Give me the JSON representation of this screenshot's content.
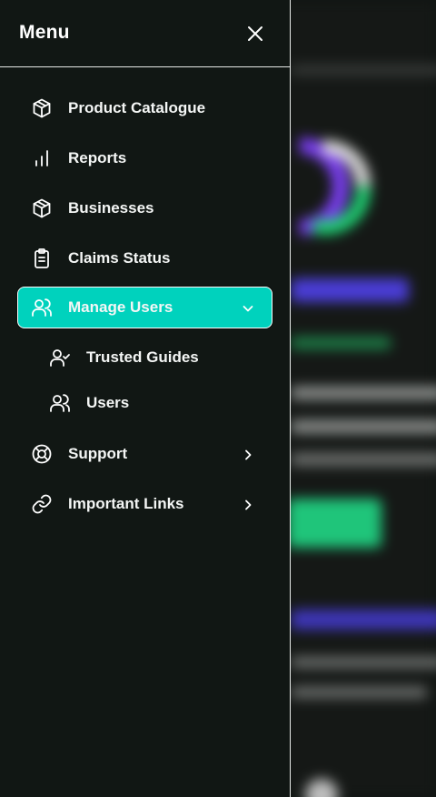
{
  "menu": {
    "title": "Menu",
    "close_icon": "close-icon"
  },
  "items": [
    {
      "label": "Product Catalogue",
      "icon": "box-icon"
    },
    {
      "label": "Reports",
      "icon": "bar-chart-icon"
    },
    {
      "label": "Businesses",
      "icon": "box-icon"
    },
    {
      "label": "Claims Status",
      "icon": "clipboard-icon"
    },
    {
      "label": "Manage Users",
      "icon": "users-icon",
      "expanded": true,
      "chevron": "chevron-down-icon",
      "children": [
        {
          "label": "Trusted Guides",
          "icon": "user-check-icon"
        },
        {
          "label": "Users",
          "icon": "users-icon"
        }
      ]
    },
    {
      "label": "Support",
      "icon": "lifebuoy-icon",
      "chevron": "chevron-right-icon"
    },
    {
      "label": "Important Links",
      "icon": "link-icon",
      "chevron": "chevron-right-icon"
    }
  ],
  "colors": {
    "drawer_bg": "#111714",
    "active_bg": "#00d2bd",
    "text": "#f4f6f5",
    "background_page": "#151816"
  }
}
